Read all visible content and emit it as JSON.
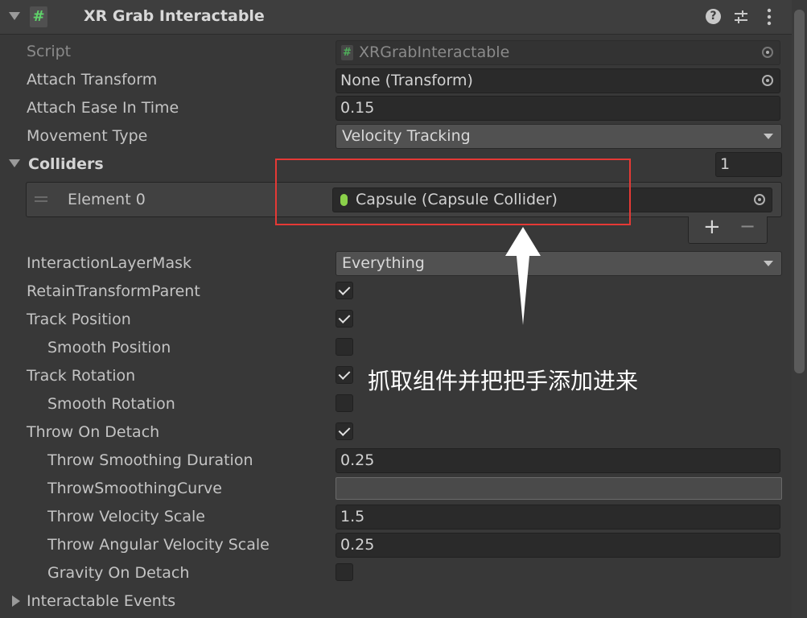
{
  "component": {
    "title": "XR Grab Interactable",
    "help_icon": "help-icon",
    "presets_icon": "sliders-icon",
    "menu_icon": "kebab-menu-icon"
  },
  "fields": {
    "script": {
      "label": "Script",
      "value": "XRGrabInteractable"
    },
    "attach_transform": {
      "label": "Attach Transform",
      "value": "None (Transform)"
    },
    "attach_ease_in_time": {
      "label": "Attach Ease In Time",
      "value": "0.15"
    },
    "movement_type": {
      "label": "Movement Type",
      "value": "Velocity Tracking"
    },
    "colliders": {
      "label": "Colliders",
      "size": "1",
      "element0_label": "Element 0",
      "element0_value": "Capsule (Capsule Collider)",
      "add": "+",
      "remove": "−"
    },
    "interaction_layer_mask": {
      "label": "InteractionLayerMask",
      "value": "Everything"
    },
    "retain_transform_parent": {
      "label": "RetainTransformParent",
      "checked": true
    },
    "track_position": {
      "label": "Track Position",
      "checked": true
    },
    "smooth_position": {
      "label": "Smooth Position",
      "checked": false
    },
    "track_rotation": {
      "label": "Track Rotation",
      "checked": true
    },
    "smooth_rotation": {
      "label": "Smooth Rotation",
      "checked": false
    },
    "throw_on_detach": {
      "label": "Throw On Detach",
      "checked": true
    },
    "throw_smoothing_duration": {
      "label": "Throw Smoothing Duration",
      "value": "0.25"
    },
    "throw_smoothing_curve": {
      "label": "ThrowSmoothingCurve"
    },
    "throw_velocity_scale": {
      "label": "Throw Velocity Scale",
      "value": "1.5"
    },
    "throw_angular_velocity_scale": {
      "label": "Throw Angular Velocity Scale",
      "value": "0.25"
    },
    "gravity_on_detach": {
      "label": "Gravity On Detach",
      "checked": false
    },
    "interactable_events": {
      "label": "Interactable Events"
    }
  },
  "annotation": {
    "text": "抓取组件并把把手添加进来",
    "highlight_color": "#e53935",
    "arrow_color": "#ffffff"
  }
}
